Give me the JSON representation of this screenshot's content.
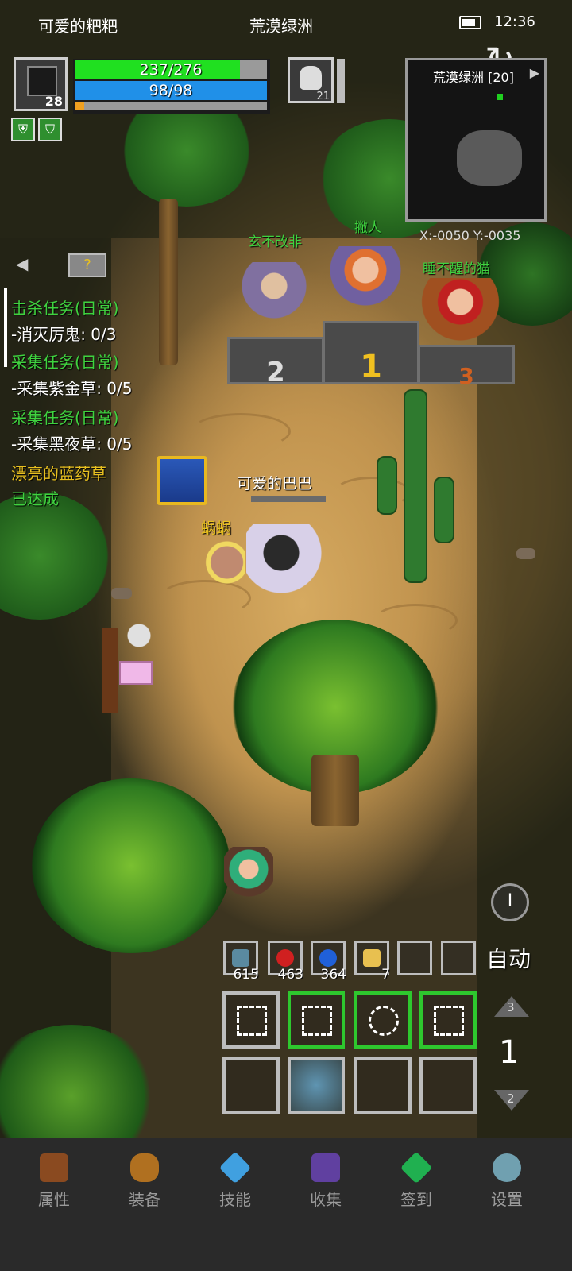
{
  "status": {
    "player_name": "可爱的粑粑",
    "location": "荒漠绿洲",
    "time": "12:36"
  },
  "player": {
    "level": "28",
    "hp": "237/276",
    "hp_ratio": 0.86,
    "mp": "98/98",
    "mp_ratio": 1.0,
    "xp_ratio": 0.05
  },
  "target": {
    "level": "21"
  },
  "minimap": {
    "title": "荒漠绿洲 [20]",
    "coords": "X:-0050  Y:-0035"
  },
  "quests": [
    {
      "title": "击杀任务(日常)",
      "detail": "-消灭厉鬼: 0/3"
    },
    {
      "title": "采集任务(日常)",
      "detail": "-采集紫金草: 0/5"
    },
    {
      "title": "采集任务(日常)",
      "detail": "-采集黑夜草: 0/5"
    },
    {
      "title": "漂亮的蓝药草",
      "detail": "已达成"
    }
  ],
  "npcs": {
    "rank2": "玄不改非",
    "rank1": "撇人",
    "rank3": "睡不醒的猫",
    "pet": "蜗蜗",
    "self": "可爱的巴巴"
  },
  "podium": {
    "first": "1",
    "second": "2",
    "third": "3"
  },
  "items": [
    {
      "icon": "fish-icon",
      "count": "615",
      "color": "#5a8aa0"
    },
    {
      "icon": "red-potion-icon",
      "count": "463",
      "color": "#d02020"
    },
    {
      "icon": "blue-potion-icon",
      "count": "364",
      "color": "#2060d8"
    },
    {
      "icon": "scroll-icon",
      "count": "7",
      "color": "#e8c050"
    }
  ],
  "hud": {
    "auto_label": "自动",
    "page": "1",
    "page_up": "3",
    "page_down": "2"
  },
  "nav": [
    {
      "label": "属性",
      "icon": "helmet-icon",
      "color": "#8a4a20"
    },
    {
      "label": "装备",
      "icon": "bag-icon",
      "color": "#b07020"
    },
    {
      "label": "技能",
      "icon": "gem-icon",
      "color": "#40a0e0"
    },
    {
      "label": "收集",
      "icon": "book-icon",
      "color": "#6040a0"
    },
    {
      "label": "签到",
      "icon": "emerald-icon",
      "color": "#20b050"
    },
    {
      "label": "设置",
      "icon": "gear-icon",
      "color": "#70a0b0"
    }
  ]
}
